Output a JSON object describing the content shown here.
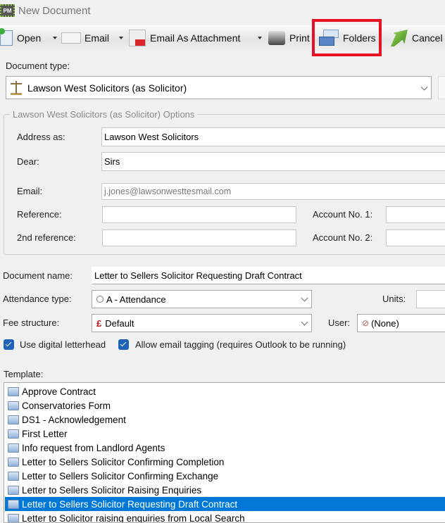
{
  "window": {
    "title": "New Document",
    "app_icon_text": "PM"
  },
  "toolbar": {
    "open": "Open",
    "email": "Email",
    "email_attachment": "Email As Attachment",
    "print": "Print",
    "folders": "Folders",
    "cancel": "Cancel",
    "highlight_color": "#e81123"
  },
  "document_type": {
    "label": "Document type:",
    "value": "Lawson West Solicitors (as Solicitor)"
  },
  "options": {
    "legend": "Lawson West Solicitors (as Solicitor) Options",
    "address_as": {
      "label": "Address as:",
      "value": "Lawson West Solicitors"
    },
    "dear": {
      "label": "Dear:",
      "value": "Sirs"
    },
    "email": {
      "label": "Email:",
      "value": "j.jones@lawsonwesttesmail.com"
    },
    "reference": {
      "label": "Reference:",
      "value": ""
    },
    "account_no_1": {
      "label": "Account No. 1:",
      "value": ""
    },
    "second_reference": {
      "label": "2nd reference:",
      "value": ""
    },
    "account_no_2": {
      "label": "Account No. 2:",
      "value": ""
    }
  },
  "document_name": {
    "label": "Document name:",
    "value": "Letter to Sellers Solicitor Requesting Draft Contract"
  },
  "attendance_type": {
    "label": "Attendance type:",
    "value": "A - Attendance"
  },
  "units": {
    "label": "Units:",
    "value": ""
  },
  "fee_structure": {
    "label": "Fee structure:",
    "value": "Default"
  },
  "user": {
    "label": "User:",
    "value": "(None)"
  },
  "checkboxes": {
    "digital_letterhead": "Use digital letterhead",
    "email_tagging": "Allow email tagging (requires Outlook to be running)"
  },
  "template": {
    "label": "Template:",
    "items": [
      "Approve Contract",
      "Conservatories Form",
      "DS1 - Acknowledgement",
      "First Letter",
      "Info request from Landlord Agents",
      "Letter to Sellers Solicitor Confirming Completion",
      "Letter to Sellers Solicitor Confirming Exchange",
      "Letter to Sellers Solicitor Raising Enquiries",
      "Letter to Sellers Solicitor Requesting Draft Contract",
      "Letter to Solicitor raising enquiries from Local Search"
    ],
    "selected_index": 8,
    "selected_color": "#0078d7"
  }
}
